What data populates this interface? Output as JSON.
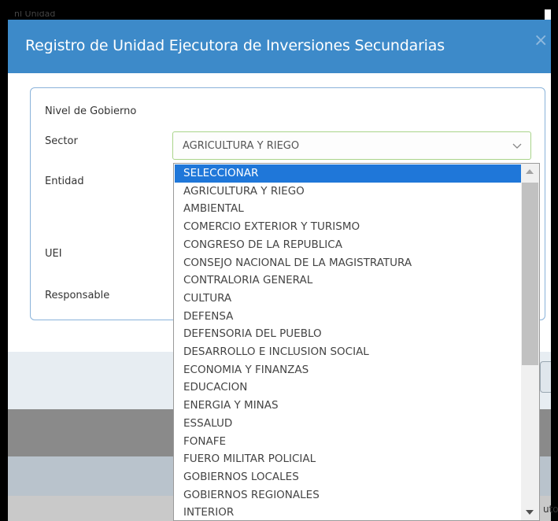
{
  "background": {
    "top_text": "nl Unidad",
    "side_text": "uto"
  },
  "modal": {
    "title": "Registro de Unidad Ejecutora de Inversiones Secundarias",
    "close_label": "×",
    "header_color": "#3d8ac9"
  },
  "form": {
    "labels": {
      "nivel": "Nivel de Gobierno",
      "sector": "Sector",
      "entidad": "Entidad",
      "uei": "UEI",
      "responsable": "Responsable"
    },
    "sector_select": {
      "value": "AGRICULTURA Y RIEGO",
      "arrow_icon": "chevron-down-icon"
    }
  },
  "dropdown": {
    "selected_index": 0,
    "options": [
      "SELECCIONAR",
      "AGRICULTURA Y RIEGO",
      "AMBIENTAL",
      "COMERCIO EXTERIOR Y TURISMO",
      "CONGRESO DE LA REPUBLICA",
      "CONSEJO NACIONAL DE LA MAGISTRATURA",
      "CONTRALORIA GENERAL",
      "CULTURA",
      "DEFENSA",
      "DEFENSORIA DEL PUEBLO",
      "DESARROLLO E INCLUSION SOCIAL",
      "ECONOMIA Y FINANZAS",
      "EDUCACION",
      "ENERGIA Y MINAS",
      "ESSALUD",
      "FONAFE",
      "FUERO MILITAR POLICIAL",
      "GOBIERNOS LOCALES",
      "GOBIERNOS REGIONALES",
      "INTERIOR"
    ],
    "highlight_color": "#1f77d9"
  }
}
